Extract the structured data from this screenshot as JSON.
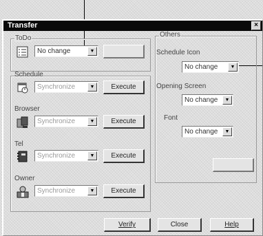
{
  "window": {
    "title": "Transfer",
    "close_glyph": "×"
  },
  "todo": {
    "label": "ToDo",
    "select_value": "No change",
    "icon": "todo-list-icon"
  },
  "schedule": {
    "label": "Schedule",
    "select_value": "Synchronize",
    "execute_label": "Execute",
    "icon": "schedule-icon"
  },
  "browser": {
    "label": "Browser",
    "select_value": "Synchronize",
    "execute_label": "Execute",
    "icon": "browser-icon"
  },
  "tel": {
    "label": "Tel",
    "select_value": "Synchronize",
    "execute_label": "Execute",
    "icon": "phonebook-icon"
  },
  "owner": {
    "label": "Owner",
    "select_value": "Synchronize",
    "execute_label": "Execute",
    "icon": "owner-icon"
  },
  "others": {
    "label": "Others",
    "schedule_icon_label": "Schedule Icon",
    "schedule_icon_value": "No change",
    "opening_screen_label": "Opening Screen",
    "opening_screen_value": "No change",
    "font_label": "Font",
    "font_value": "No change"
  },
  "footer": {
    "verify_label": "Verify",
    "close_label": "Close",
    "help_label": "Help"
  },
  "arrow_glyph": "▼"
}
